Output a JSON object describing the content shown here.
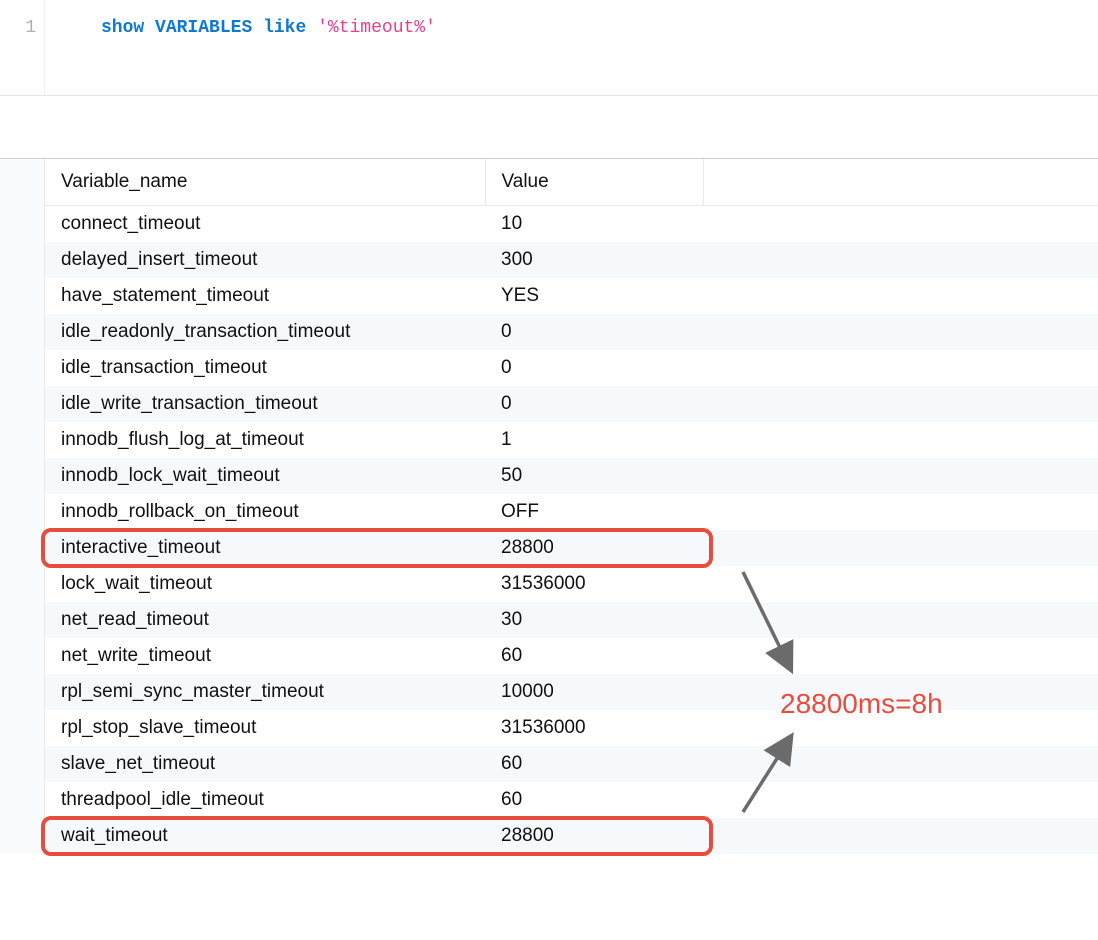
{
  "editor": {
    "line_number": "1",
    "sql_keyword_show": "show",
    "sql_variables": "VARIABLES",
    "sql_like": "like",
    "sql_string": "'%timeout%'"
  },
  "headers": {
    "name": "Variable_name",
    "value": "Value"
  },
  "rows": [
    {
      "name": "connect_timeout",
      "value": "10",
      "highlight": false
    },
    {
      "name": "delayed_insert_timeout",
      "value": "300",
      "highlight": false
    },
    {
      "name": "have_statement_timeout",
      "value": "YES",
      "highlight": false
    },
    {
      "name": "idle_readonly_transaction_timeout",
      "value": "0",
      "highlight": false
    },
    {
      "name": "idle_transaction_timeout",
      "value": "0",
      "highlight": false
    },
    {
      "name": "idle_write_transaction_timeout",
      "value": "0",
      "highlight": false
    },
    {
      "name": "innodb_flush_log_at_timeout",
      "value": "1",
      "highlight": false
    },
    {
      "name": "innodb_lock_wait_timeout",
      "value": "50",
      "highlight": false
    },
    {
      "name": "innodb_rollback_on_timeout",
      "value": "OFF",
      "highlight": false
    },
    {
      "name": "interactive_timeout",
      "value": "28800",
      "highlight": true
    },
    {
      "name": "lock_wait_timeout",
      "value": "31536000",
      "highlight": false
    },
    {
      "name": "net_read_timeout",
      "value": "30",
      "highlight": false
    },
    {
      "name": "net_write_timeout",
      "value": "60",
      "highlight": false
    },
    {
      "name": "rpl_semi_sync_master_timeout",
      "value": "10000",
      "highlight": false
    },
    {
      "name": "rpl_stop_slave_timeout",
      "value": "31536000",
      "highlight": false
    },
    {
      "name": "slave_net_timeout",
      "value": "60",
      "highlight": false
    },
    {
      "name": "threadpool_idle_timeout",
      "value": "60",
      "highlight": false
    },
    {
      "name": "wait_timeout",
      "value": "28800",
      "highlight": true
    }
  ],
  "annotation": {
    "text": "28800ms=8h",
    "color_hex": "#e84c3d"
  }
}
